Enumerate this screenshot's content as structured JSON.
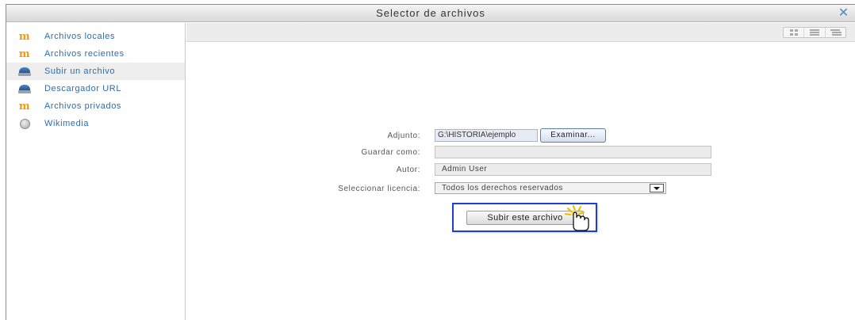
{
  "window": {
    "title": "Selector de archivos",
    "close_glyph": "✕"
  },
  "sidebar": {
    "items": [
      {
        "label": "Archivos locales",
        "icon": "moodle-icon"
      },
      {
        "label": "Archivos recientes",
        "icon": "moodle-icon"
      },
      {
        "label": "Subir un archivo",
        "icon": "upload-icon",
        "active": true
      },
      {
        "label": "Descargador URL",
        "icon": "upload-icon"
      },
      {
        "label": "Archivos privados",
        "icon": "moodle-icon"
      },
      {
        "label": "Wikimedia",
        "icon": "globe-icon"
      }
    ],
    "moodle_glyph": "m"
  },
  "toolbar": {
    "view_buttons": [
      "grid-view-icon",
      "list-view-icon",
      "tree-view-icon"
    ]
  },
  "form": {
    "attachment_label": "Adjunto:",
    "attachment_value": "G:\\HISTORIA\\ejemplo",
    "browse_label": "Examinar...",
    "save_as_label": "Guardar como:",
    "save_as_value": "",
    "author_label": "Autor:",
    "author_value": "Admin User",
    "license_label": "Seleccionar licencia:",
    "license_value": "Todos los derechos reservados",
    "upload_label": "Subir este archivo"
  },
  "colors": {
    "link": "#2d6bb5",
    "highlight_border": "#1f3fd1",
    "moodle_orange": "#f39a00"
  }
}
